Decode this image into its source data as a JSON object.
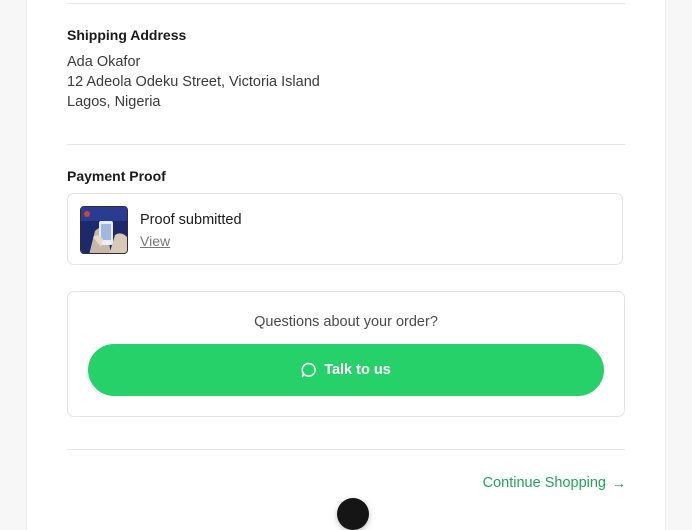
{
  "shipping": {
    "title": "Shipping Address",
    "name": "Ada Okafor",
    "street": "12 Adeola Odeku Street, Victoria Island",
    "city": "Lagos, Nigeria"
  },
  "payment": {
    "title": "Payment Proof",
    "status": "Proof submitted",
    "view_label": "View",
    "thumbnail_icon": "payment-proof-thumbnail"
  },
  "help": {
    "question": "Questions about your order?",
    "button_label": "Talk to us",
    "button_icon": "chat-bubble-icon",
    "button_color": "#26d16a"
  },
  "footer": {
    "continue_label": "Continue Shopping",
    "continue_icon": "arrow-right-icon",
    "link_color": "#22a35a"
  }
}
